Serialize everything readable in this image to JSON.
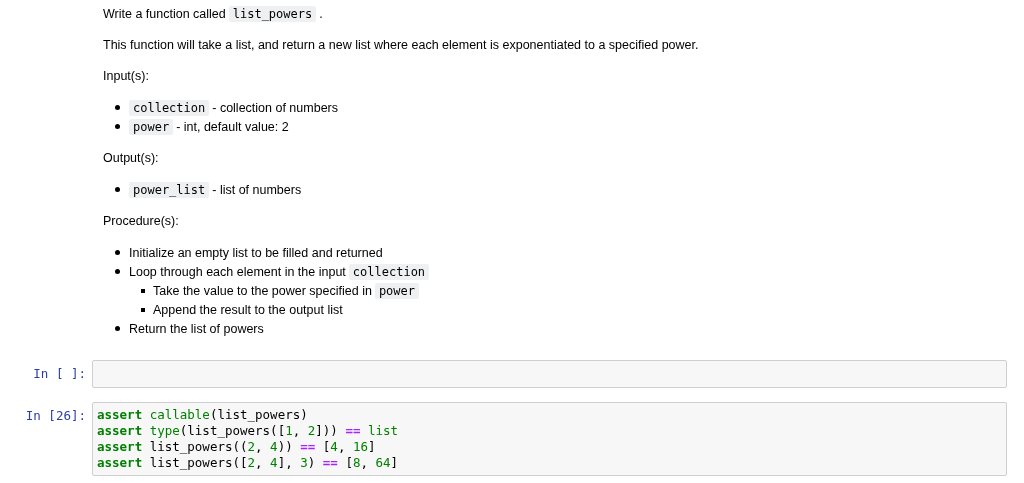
{
  "markdown_cell": {
    "blocks": [
      {
        "kind": "paragraph",
        "segments": [
          {
            "kind": "text",
            "text": "Write a function called"
          },
          {
            "kind": "code",
            "text": "list_powers"
          },
          {
            "kind": "text",
            "text": "."
          }
        ]
      },
      {
        "kind": "paragraph",
        "segments": [
          {
            "kind": "text",
            "text": "This function will take a list, and return a new list where each element is exponentiated to a specified power."
          }
        ]
      },
      {
        "kind": "paragraph",
        "segments": [
          {
            "kind": "text",
            "text": "Input(s):"
          }
        ]
      },
      {
        "kind": "list",
        "items": [
          {
            "segments": [
              {
                "kind": "code",
                "text": "collection"
              },
              {
                "kind": "text",
                "text": "- collection of numbers"
              }
            ]
          },
          {
            "segments": [
              {
                "kind": "code",
                "text": "power"
              },
              {
                "kind": "text",
                "text": "- int, default value: 2"
              }
            ]
          }
        ]
      },
      {
        "kind": "paragraph",
        "segments": [
          {
            "kind": "text",
            "text": "Output(s):"
          }
        ]
      },
      {
        "kind": "list",
        "items": [
          {
            "segments": [
              {
                "kind": "code",
                "text": "power_list"
              },
              {
                "kind": "text",
                "text": "- list of numbers"
              }
            ]
          }
        ]
      },
      {
        "kind": "paragraph",
        "segments": [
          {
            "kind": "text",
            "text": "Procedure(s):"
          }
        ]
      },
      {
        "kind": "list",
        "items": [
          {
            "segments": [
              {
                "kind": "text",
                "text": "Initialize an empty list to be filled and returned"
              }
            ]
          },
          {
            "segments": [
              {
                "kind": "text",
                "text": "Loop through each element in the input"
              },
              {
                "kind": "code",
                "text": "collection"
              }
            ],
            "children": [
              {
                "segments": [
                  {
                    "kind": "text",
                    "text": "Take the value to the power specified in"
                  },
                  {
                    "kind": "code",
                    "text": "power"
                  }
                ]
              },
              {
                "segments": [
                  {
                    "kind": "text",
                    "text": "Append the result to the output list"
                  }
                ]
              }
            ]
          },
          {
            "segments": [
              {
                "kind": "text",
                "text": "Return the list of powers"
              }
            ]
          }
        ]
      }
    ]
  },
  "code_cells": [
    {
      "kind": "empty",
      "prompt": "In [ ]:"
    },
    {
      "kind": "code",
      "prompt": "In [26]:",
      "lines": [
        [
          {
            "kind": "keyword",
            "text": "assert "
          },
          {
            "kind": "builtin",
            "text": "callable"
          },
          {
            "kind": "plain",
            "text": "(list_powers)"
          }
        ],
        [
          {
            "kind": "keyword",
            "text": "assert "
          },
          {
            "kind": "builtin",
            "text": "type"
          },
          {
            "kind": "plain",
            "text": "(list_powers(["
          },
          {
            "kind": "number",
            "text": "1"
          },
          {
            "kind": "plain",
            "text": ", "
          },
          {
            "kind": "number",
            "text": "2"
          },
          {
            "kind": "plain",
            "text": "])) "
          },
          {
            "kind": "operator",
            "text": "== "
          },
          {
            "kind": "builtin",
            "text": "list"
          }
        ],
        [
          {
            "kind": "keyword",
            "text": "assert"
          },
          {
            "kind": "plain",
            "text": " list_powers(("
          },
          {
            "kind": "number",
            "text": "2"
          },
          {
            "kind": "plain",
            "text": ", "
          },
          {
            "kind": "number",
            "text": "4"
          },
          {
            "kind": "plain",
            "text": ")) "
          },
          {
            "kind": "operator",
            "text": "=="
          },
          {
            "kind": "plain",
            "text": " ["
          },
          {
            "kind": "number",
            "text": "4"
          },
          {
            "kind": "plain",
            "text": ", "
          },
          {
            "kind": "number",
            "text": "16"
          },
          {
            "kind": "plain",
            "text": "]"
          }
        ],
        [
          {
            "kind": "keyword",
            "text": "assert"
          },
          {
            "kind": "plain",
            "text": " list_powers(["
          },
          {
            "kind": "number",
            "text": "2"
          },
          {
            "kind": "plain",
            "text": ", "
          },
          {
            "kind": "number",
            "text": "4"
          },
          {
            "kind": "plain",
            "text": "], "
          },
          {
            "kind": "number",
            "text": "3"
          },
          {
            "kind": "plain",
            "text": ") "
          },
          {
            "kind": "operator",
            "text": "=="
          },
          {
            "kind": "plain",
            "text": " ["
          },
          {
            "kind": "number",
            "text": "8"
          },
          {
            "kind": "plain",
            "text": ", "
          },
          {
            "kind": "number",
            "text": "64"
          },
          {
            "kind": "plain",
            "text": "]"
          }
        ]
      ]
    }
  ]
}
